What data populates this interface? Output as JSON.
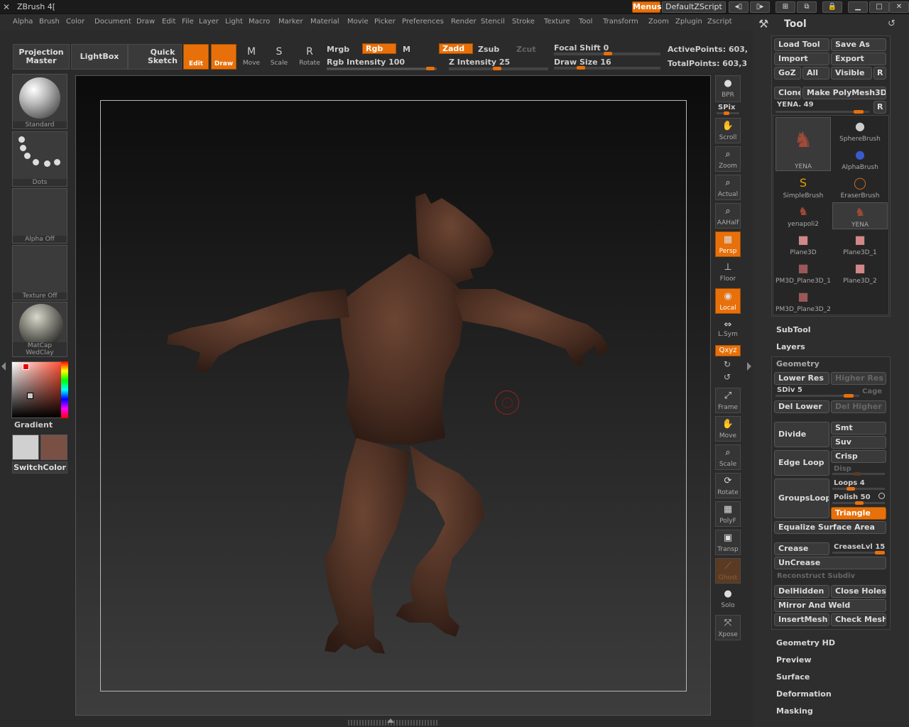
{
  "titlebar": {
    "title": "ZBrush 4[",
    "menus": "Menus",
    "script": "DefaultZScript"
  },
  "menu": [
    "Alpha",
    "Brush",
    "Color",
    "Document",
    "Draw",
    "Edit",
    "File",
    "Layer",
    "Light",
    "Macro",
    "Marker",
    "Material",
    "Movie",
    "Picker",
    "Preferences",
    "Render",
    "Stencil",
    "Stroke",
    "Texture",
    "Tool",
    "Transform",
    "Zoom",
    "Zplugin",
    "Zscript"
  ],
  "toolbar": {
    "projection": "Projection\nMaster",
    "lightbox": "LightBox",
    "quicksketch": "Quick\nSketch",
    "edit": "Edit",
    "draw": "Draw",
    "move": "Move",
    "scale": "Scale",
    "rotate": "Rotate",
    "mrgb": "Mrgb",
    "rgb": "Rgb",
    "m": "M",
    "zadd": "Zadd",
    "zsub": "Zsub",
    "zcut": "Zcut",
    "rgb_intensity": "Rgb Intensity 100",
    "z_intensity": "Z Intensity 25",
    "focal_shift": "Focal Shift 0",
    "draw_size": "Draw Size 16",
    "active_points": "ActivePoints: 603,",
    "total_points": "TotalPoints: 603,3"
  },
  "leftshelf": {
    "standard": "Standard",
    "dots": "Dots",
    "alpha": "Alpha Off",
    "texture": "Texture Off",
    "matcap": "MatCap WedClay",
    "gradient": "Gradient",
    "switchcolor": "SwitchColor"
  },
  "rightshelf": {
    "bpr": "BPR",
    "spix": "SPix",
    "scroll": "Scroll",
    "zoom": "Zoom",
    "actual": "Actual",
    "aahalf": "AAHalf",
    "persp": "Persp",
    "floor": "Floor",
    "local": "Local",
    "lsym": "L.Sym",
    "xyz": "Qxyz",
    "frame": "Frame",
    "move": "Move",
    "scale": "Scale",
    "rotate": "Rotate",
    "polyf": "PolyF",
    "transp": "Transp",
    "ghost": "Ghost",
    "solo": "Solo",
    "xpose": "Xpose"
  },
  "panel": {
    "title": "Tool",
    "load_tool": "Load Tool",
    "save_as": "Save As",
    "import": "Import",
    "export": "Export",
    "goz": "GoZ",
    "all": "All",
    "visible": "Visible",
    "r": "R",
    "clone": "Clone",
    "make_polymesh": "Make PolyMesh3D",
    "current": "YENA. 49",
    "tools": [
      "YENA",
      "SphereBrush",
      "AlphaBrush",
      "SimpleBrush",
      "EraserBrush",
      "yenapoli2",
      "YENA",
      "Plane3D",
      "Plane3D_1",
      "PM3D_Plane3D_1",
      "Plane3D_2",
      "PM3D_Plane3D_2"
    ],
    "subtool": "SubTool",
    "layers": "Layers",
    "geometry": "Geometry",
    "lower_res": "Lower Res",
    "higher_res": "Higher Res",
    "sdiv": "SDiv 5",
    "cage": "Cage",
    "del_lower": "Del Lower",
    "del_higher": "Del Higher",
    "divide": "Divide",
    "smt": "Smt",
    "suv": "Suv",
    "edge_loop": "Edge Loop",
    "crisp": "Crisp",
    "disp": "Disp",
    "groupsloops": "GroupsLoops",
    "loops": "Loops 4",
    "polish": "Polish 50",
    "triangle": "Triangle",
    "equalize": "Equalize Surface Area",
    "crease": "Crease",
    "creaselvl": "CreaseLvl 15",
    "uncrease": "UnCrease",
    "reconstruct": "Reconstruct Subdiv",
    "delhidden": "DelHidden",
    "close_holes": "Close Holes",
    "mirror_weld": "Mirror And Weld",
    "insertmesh": "InsertMesh",
    "check_mesh": "Check Mesh",
    "geometry_hd": "Geometry HD",
    "preview": "Preview",
    "surface": "Surface",
    "deformation": "Deformation",
    "masking": "Masking"
  },
  "colors": {
    "accent": "#e8700a",
    "main_color": "#d0d0d0",
    "secondary_color": "#7a5045",
    "model": "#5a3a2c"
  }
}
